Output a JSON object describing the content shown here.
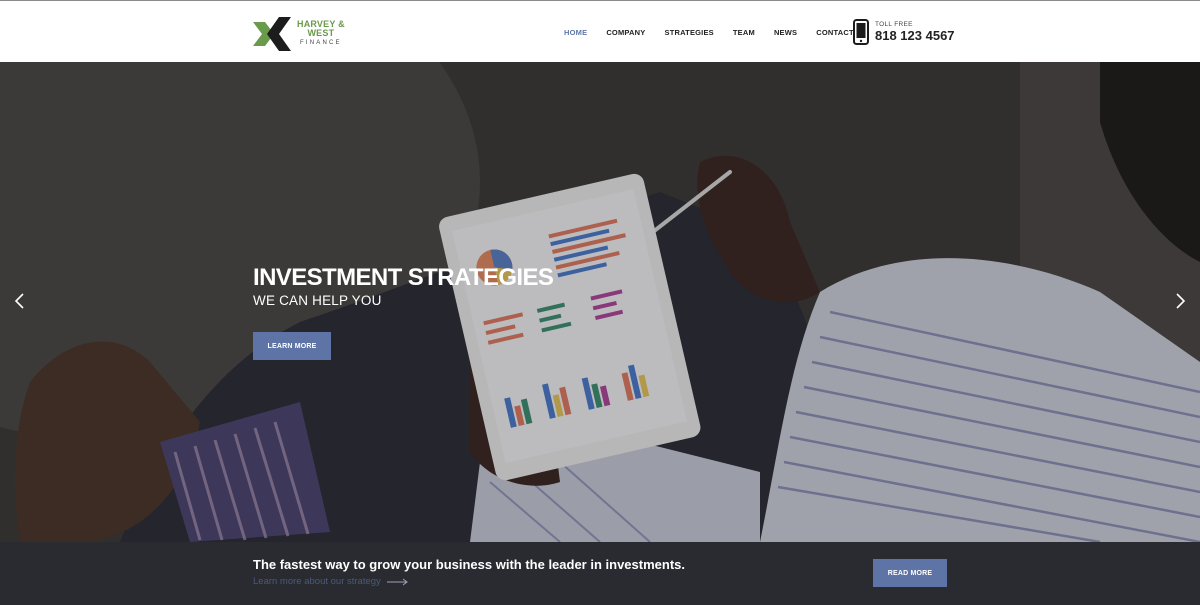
{
  "header": {
    "logo": {
      "line1": "HARVEY &",
      "line2": "WEST",
      "line3": "FINANCE"
    },
    "nav": [
      {
        "label": "HOME",
        "active": true
      },
      {
        "label": "COMPANY",
        "active": false
      },
      {
        "label": "STRATEGIES",
        "active": false
      },
      {
        "label": "TEAM",
        "active": false
      },
      {
        "label": "NEWS",
        "active": false
      },
      {
        "label": "CONTACT",
        "active": false
      }
    ],
    "phone": {
      "label": "TOLL FREE",
      "number": "818 123 4567",
      "icon": "mobile-phone-icon"
    }
  },
  "hero": {
    "title": "INVESTMENT STRATEGIES",
    "subtitle": "WE CAN HELP YOU",
    "button_label": "LEARN MORE",
    "prev_icon": "chevron-left-icon",
    "next_icon": "chevron-right-icon"
  },
  "bottom": {
    "title": "The fastest way to grow your business with the leader in investments.",
    "link_text": "Learn more about our strategy",
    "link_icon": "arrow-right-icon",
    "button_label": "READ MORE"
  },
  "colors": {
    "accent": "#5e73a6",
    "logo_green": "#6a9a4c",
    "nav_active": "#5f78a8",
    "bottom_bar": "#2a2b30"
  }
}
